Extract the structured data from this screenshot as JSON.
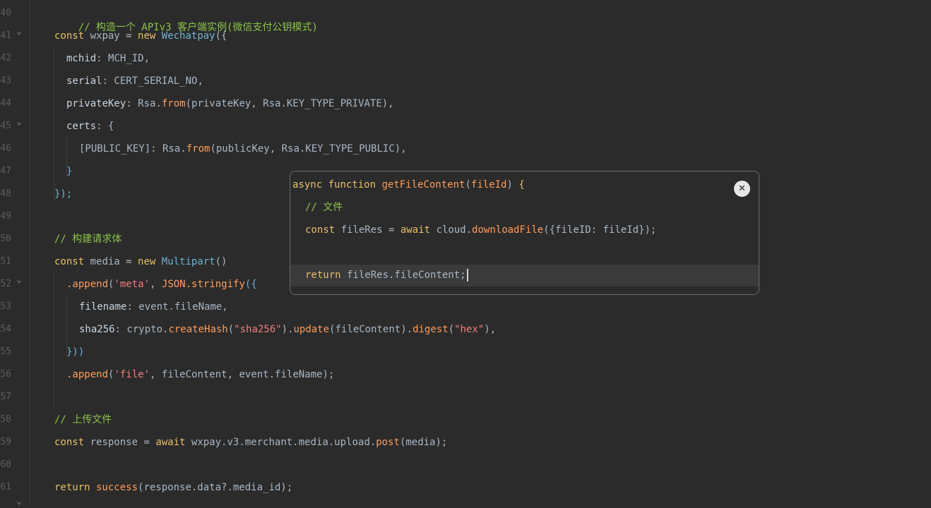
{
  "gutter": {
    "line_numbers": [
      "40",
      "41",
      "42",
      "43",
      "44",
      "45",
      "46",
      "47",
      "48",
      "49",
      "50",
      "51",
      "52",
      "53",
      "54",
      "55",
      "56",
      "57",
      "58",
      "59",
      "60",
      "61"
    ],
    "fold_icons": [
      "chevron-down-icon",
      "chevron-down-icon",
      "chevron-down-icon"
    ]
  },
  "code": {
    "l40_comment": "// 构造一个 APIv3 客户端实例(微信支付公钥模式)",
    "l41_kw": "const",
    "l41_var": " wxpay = ",
    "l41_new": "new",
    "l41_cls": " Wechatpay",
    "l41_end": "({",
    "l42_key": "mchid",
    "l42_rest": ": MCH_ID,",
    "l43_key": "serial",
    "l43_rest": ": CERT_SERIAL_NO,",
    "l44_key": "privateKey",
    "l44_a": ": Rsa.",
    "l44_fn": "from",
    "l44_b": "(privateKey, Rsa.KEY_TYPE_PRIVATE),",
    "l45_key": "certs",
    "l45_rest": ": {",
    "l46_a": "[PUBLIC_KEY]: Rsa.",
    "l46_fn": "from",
    "l46_b": "(publicKey, Rsa.KEY_TYPE_PUBLIC),",
    "l47": "}",
    "l48": "});",
    "l50_comment": "// 构建请求体",
    "l51_kw": "const",
    "l51_var": " media = ",
    "l51_new": "new",
    "l51_cls": " Multipart",
    "l51_end": "()",
    "l52_fn": ".append",
    "l52_a": "(",
    "l52_str": "'meta'",
    "l52_b": ", ",
    "l52_cls": "JSON",
    "l52_fn2": ".stringify",
    "l52_c": "({",
    "l53_key": "filename",
    "l53_rest": ": event.fileName,",
    "l54_key": "sha256",
    "l54_a": ": crypto.",
    "l54_fn": "createHash",
    "l54_b": "(",
    "l54_str": "\"sha256\"",
    "l54_c": ").",
    "l54_fn2": "update",
    "l54_d": "(fileContent).",
    "l54_fn3": "digest",
    "l54_e": "(",
    "l54_str2": "\"hex\"",
    "l54_f": "),",
    "l55": "}))",
    "l56_fn": ".append",
    "l56_a": "(",
    "l56_str": "'file'",
    "l56_b": ", fileContent, event.fileName);",
    "l58_comment": "// 上传文件",
    "l59_kw": "const",
    "l59_var": " response = ",
    "l59_aw": "await",
    "l59_a": " wxpay.v3.merchant.media.upload.",
    "l59_fn": "post",
    "l59_b": "(media);",
    "l61_kw": "return",
    "l61_fn": " success",
    "l61_a": "(response.data?.media_id);"
  },
  "popup": {
    "p1_kw": "async",
    "p1_kw2": " function",
    "p1_fn": " getFileContent",
    "p1_a": "(",
    "p1_param": "fileId",
    "p1_b": ") ",
    "p1_br": "{",
    "p2_comment": "// 文件",
    "p3_kw": "const",
    "p3_var": " fileRes = ",
    "p3_aw": "await",
    "p3_a": " cloud.",
    "p3_fn": "downloadFile",
    "p3_b": "({fileID: fileId});",
    "p5_kw": "return",
    "p5_a": " fileRes.fileContent;",
    "close_label": "✕"
  }
}
